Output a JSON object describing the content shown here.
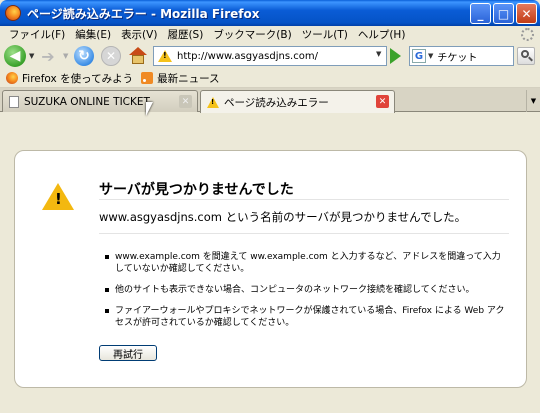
{
  "window": {
    "title": "ページ読み込みエラー - Mozilla Firefox"
  },
  "menu": [
    "ファイル(F)",
    "編集(E)",
    "表示(V)",
    "履歴(S)",
    "ブックマーク(B)",
    "ツール(T)",
    "ヘルプ(H)"
  ],
  "nav": {
    "url": "http://www.asgyasdjns.com/",
    "search_value": "チケット"
  },
  "bookmarks": [
    {
      "label": "Firefox を使ってみよう",
      "icon": "firefox-icon"
    },
    {
      "label": "最新ニュース",
      "icon": "rss-icon"
    }
  ],
  "tabs": [
    {
      "label": "SUZUKA ONLINE TICKET",
      "active": false
    },
    {
      "label": "ページ読み込みエラー",
      "active": true
    }
  ],
  "error": {
    "title": "サーバが見つかりませんでした",
    "short": "www.asgyasdjns.com という名前のサーバが見つかりませんでした。",
    "items": [
      "www.example.com を間違えて ww.example.com と入力するなど、アドレスを間違って入力していないか確認してください。",
      "他のサイトも表示できない場合、コンピュータのネットワーク接続を確認してください。",
      "ファイアーウォールやプロキシでネットワークが保護されている場合、Firefox による Web アクセスが許可されているか確認してください。"
    ],
    "retry_label": "再試行"
  }
}
